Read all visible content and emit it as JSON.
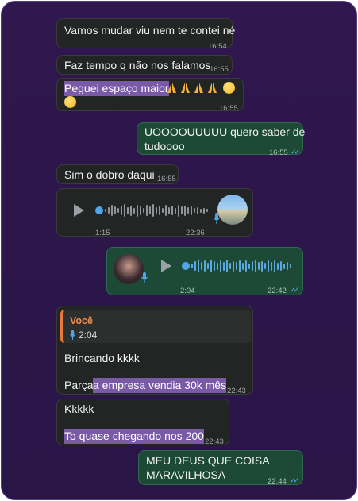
{
  "messages": [
    {
      "text": "Vamos mudar viu nem te contei né",
      "time": "16:54"
    },
    {
      "text": "Faz tempo q não nos falamos",
      "time": "16:55"
    },
    {
      "text": "Peguei espaço maior",
      "time": "16:55"
    },
    {
      "text_line1": "UOOOOUUUUU quero saber de",
      "text_line2": "tudoooo",
      "time": "16:55"
    },
    {
      "text": "Sim o dobro daqui",
      "time": "16:55"
    },
    {
      "duration": "1:15",
      "time": "22:36"
    },
    {
      "duration": "2:04",
      "time": "22:42"
    },
    {
      "quote_name": "Você",
      "quote_duration": "2:04",
      "line1": "Brincando kkkk",
      "line2_prefix": "Parça",
      "line2_highlight": "a empresa vendia 30k mês",
      "time": "22:43"
    },
    {
      "line1": "Kkkkk",
      "line2": "To quase chegando nos 200",
      "time": "22:43"
    },
    {
      "line1": "MEU DEUS QUE COISA",
      "line2": "MARAVILHOSA",
      "time": "22:44"
    }
  ],
  "colors": {
    "incoming": "#222524",
    "outgoing": "#1d4a37",
    "highlight": "#7a5aa6",
    "read_checks": "#5fb2f1",
    "background": "#2d1649"
  },
  "icons": {
    "read": "double-check-icon",
    "play": "play-icon",
    "mic": "mic-icon",
    "pray": "folded-hands-emoji",
    "face": "astonished-face-emoji"
  }
}
